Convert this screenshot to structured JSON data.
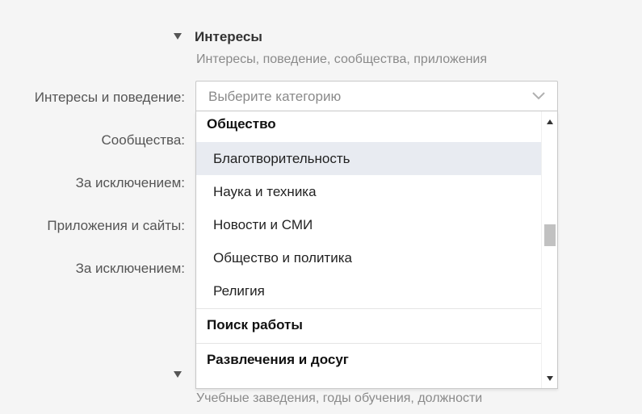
{
  "section": {
    "title": "Интересы",
    "subtitle": "Интересы, поведение, сообщества, приложения"
  },
  "fields": {
    "interests_label": "Интересы и поведение:",
    "communities_label": "Сообщества:",
    "exclude1_label": "За исключением:",
    "apps_label": "Приложения и сайты:",
    "exclude2_label": "За исключением:"
  },
  "select": {
    "placeholder": "Выберите категорию"
  },
  "dropdown": {
    "group_society": "Общество",
    "options": [
      "Благотворительность",
      "Наука и техника",
      "Новости и СМИ",
      "Общество и политика",
      "Религия"
    ],
    "group_jobs": "Поиск работы",
    "group_entertainment": "Развлечения и досуг"
  },
  "next_section": {
    "subtitle": "Учебные заведения, годы обучения, должности"
  },
  "colors": {
    "highlight": "#e8ebf1",
    "background": "#f5f5f5"
  }
}
